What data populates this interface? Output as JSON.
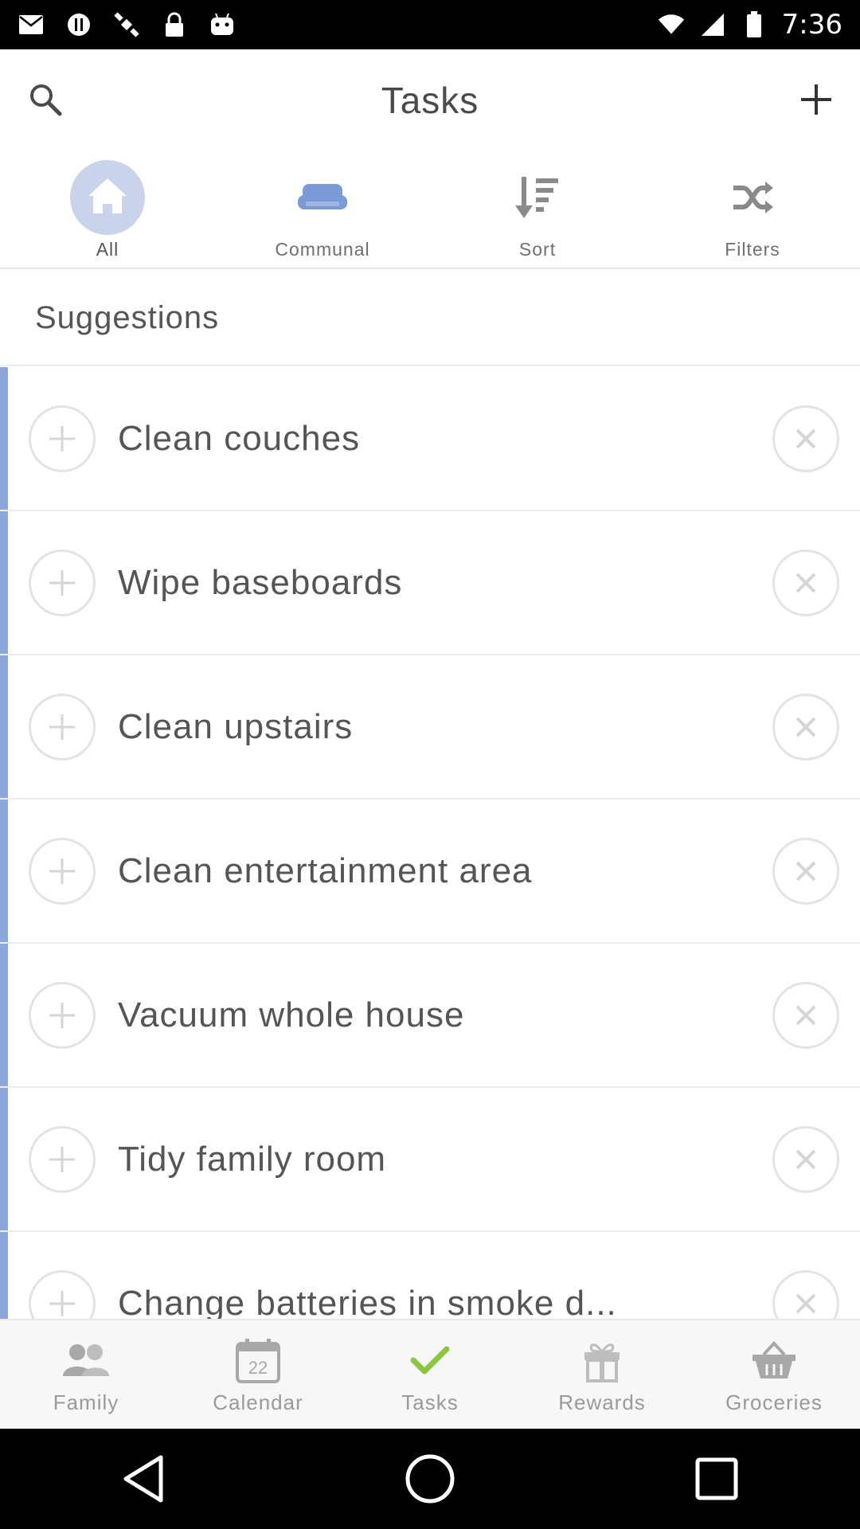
{
  "status_bar": {
    "time": "7:36",
    "left_icons": [
      "mail-icon",
      "alert-icon",
      "satellite-icon",
      "lock-icon",
      "android-icon"
    ],
    "right_icons": [
      "wifi-icon",
      "signal-icon",
      "battery-icon"
    ]
  },
  "header": {
    "title": "Tasks",
    "search_icon": "search-icon",
    "add_icon": "plus-icon"
  },
  "categories": [
    {
      "label": "All",
      "icon": "home-icon"
    },
    {
      "label": "Communal",
      "icon": "couch-icon"
    },
    {
      "label": "Sort",
      "icon": "sort-icon"
    },
    {
      "label": "Filters",
      "icon": "shuffle-icon"
    }
  ],
  "suggestions": {
    "title": "Suggestions",
    "items": [
      {
        "label": "Clean couches"
      },
      {
        "label": "Wipe baseboards"
      },
      {
        "label": "Clean upstairs"
      },
      {
        "label": "Clean entertainment area"
      },
      {
        "label": "Vacuum whole house"
      },
      {
        "label": "Tidy family room"
      },
      {
        "label": "Change batteries in smoke d..."
      }
    ]
  },
  "bottom_nav": [
    {
      "label": "Family",
      "icon": "family-icon"
    },
    {
      "label": "Calendar",
      "icon": "calendar-icon",
      "day": "22"
    },
    {
      "label": "Tasks",
      "icon": "check-icon"
    },
    {
      "label": "Rewards",
      "icon": "gift-icon"
    },
    {
      "label": "Groceries",
      "icon": "basket-icon"
    }
  ],
  "colors": {
    "accent_blue": "#8aa8dc",
    "active_home_bg": "#c9d4ea",
    "check_green": "#8cc63f",
    "icon_gray": "#8a8a8a"
  }
}
